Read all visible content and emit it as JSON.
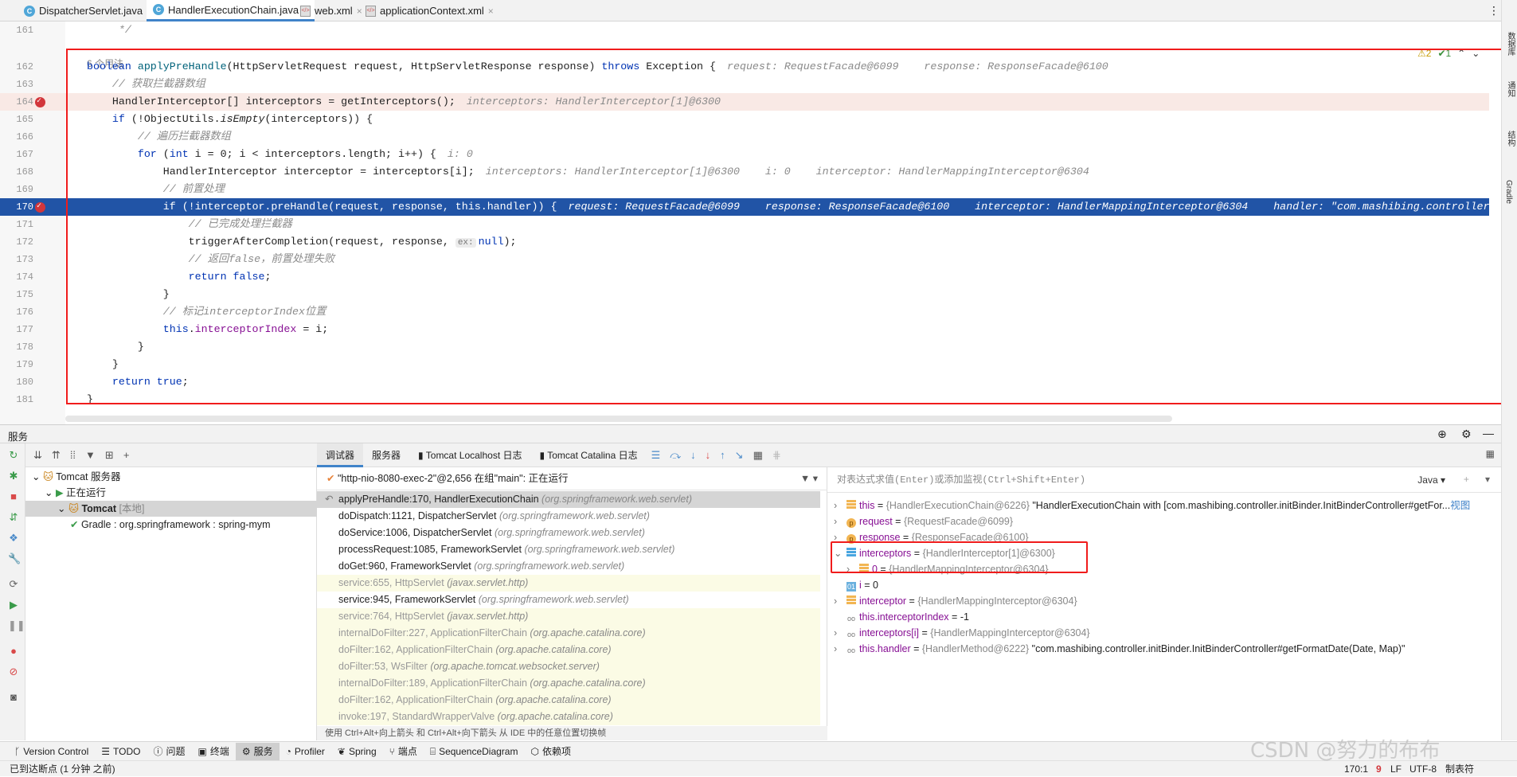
{
  "tabs": [
    {
      "label": "DispatcherServlet.java",
      "icon": "class-icon"
    },
    {
      "label": "HandlerExecutionChain.java",
      "icon": "class-icon",
      "active": true
    },
    {
      "label": "web.xml",
      "icon": "xml-icon"
    },
    {
      "label": "applicationContext.xml",
      "icon": "xml-icon"
    }
  ],
  "editor": {
    "usage": "6 个用法",
    "inspections": {
      "warnings": "⚠2",
      "ok": "✔1"
    },
    "lines": [
      {
        "num": "161",
        "seg": [
          [
            "     */",
            "cm"
          ]
        ]
      },
      {
        "num": "162",
        "seg": [
          [
            "boolean ",
            "kw"
          ],
          [
            "applyPreHandle",
            "fn"
          ],
          [
            "(HttpServletRequest request, HttpServletResponse response) ",
            ""
          ],
          [
            "throws ",
            "kw"
          ],
          [
            "Exception {",
            ""
          ]
        ],
        "hint": "request: RequestFacade@6099    response: ResponseFacade@6100"
      },
      {
        "num": "163",
        "seg": [
          [
            "    // 获取拦截器数组",
            "cm"
          ]
        ]
      },
      {
        "num": "164",
        "seg": [
          [
            "    HandlerInterceptor[] interceptors = getInterceptors();",
            ""
          ]
        ],
        "hint": "interceptors: HandlerInterceptor[1]@6300",
        "bg": "pink",
        "bp": true
      },
      {
        "num": "165",
        "seg": [
          [
            "    ",
            ""
          ],
          [
            "if ",
            "kw"
          ],
          [
            "(!ObjectUtils.",
            ""
          ],
          [
            "isEmpty",
            "it"
          ],
          [
            "(interceptors)) {",
            ""
          ]
        ]
      },
      {
        "num": "166",
        "seg": [
          [
            "        // 遍历拦截器数组",
            "cm"
          ]
        ]
      },
      {
        "num": "167",
        "seg": [
          [
            "        ",
            ""
          ],
          [
            "for ",
            "kw"
          ],
          [
            "(",
            ""
          ],
          [
            "int ",
            "kw"
          ],
          [
            "i = 0; i < interceptors.length; i++) {",
            ""
          ]
        ],
        "hint": "i: 0"
      },
      {
        "num": "168",
        "seg": [
          [
            "            HandlerInterceptor interceptor = interceptors[i];",
            ""
          ]
        ],
        "hint": "interceptors: HandlerInterceptor[1]@6300    i: 0    interceptor: HandlerMappingInterceptor@6304"
      },
      {
        "num": "169",
        "seg": [
          [
            "            // 前置处理",
            "cm"
          ]
        ]
      },
      {
        "num": "170",
        "seg": [
          [
            "            if (!interceptor.preHandle(request, response, this.handler)) {",
            ""
          ]
        ],
        "hint": "request: RequestFacade@6099    response: ResponseFacade@6100    interceptor: HandlerMappingInterceptor@6304    handler: \"com.mashibing.controller.",
        "bg": "sel",
        "bp": true
      },
      {
        "num": "171",
        "seg": [
          [
            "                // 已完成处理拦截器",
            "cm"
          ]
        ]
      },
      {
        "num": "172",
        "seg": [
          [
            "                triggerAfterCompletion(request, response, ",
            ""
          ],
          [
            "ex:",
            "inlay"
          ],
          [
            "null",
            "kw"
          ],
          [
            ");",
            ""
          ]
        ]
      },
      {
        "num": "173",
        "seg": [
          [
            "                // 返回false，前置处理失败",
            "cm"
          ]
        ]
      },
      {
        "num": "174",
        "seg": [
          [
            "                ",
            ""
          ],
          [
            "return false",
            "kw"
          ],
          [
            ";",
            ""
          ]
        ]
      },
      {
        "num": "175",
        "seg": [
          [
            "            }",
            ""
          ]
        ]
      },
      {
        "num": "176",
        "seg": [
          [
            "            // 标记interceptorIndex位置",
            "cm"
          ]
        ]
      },
      {
        "num": "177",
        "seg": [
          [
            "            ",
            ""
          ],
          [
            "this",
            "kw"
          ],
          [
            ".",
            ""
          ],
          [
            "interceptorIndex",
            "fd"
          ],
          [
            " = i;",
            ""
          ]
        ]
      },
      {
        "num": "178",
        "seg": [
          [
            "        }",
            ""
          ]
        ]
      },
      {
        "num": "179",
        "seg": [
          [
            "    }",
            ""
          ]
        ]
      },
      {
        "num": "180",
        "seg": [
          [
            "    ",
            ""
          ],
          [
            "return true",
            "kw"
          ],
          [
            ";",
            ""
          ]
        ]
      },
      {
        "num": "181",
        "seg": [
          [
            "}",
            ""
          ]
        ]
      }
    ]
  },
  "right_strip": [
    "数据库",
    "通知",
    "结构",
    "Gradle"
  ],
  "services": {
    "title": "服务",
    "tree": [
      {
        "label": "Tomcat 服务器",
        "indent": 0
      },
      {
        "label": "正在运行",
        "indent": 1
      },
      {
        "label": "Tomcat",
        "extra": "[本地]",
        "indent": 2,
        "selected": true
      },
      {
        "label": "Gradle : org.springframework : spring-mym",
        "indent": 3
      }
    ],
    "debug_tabs": [
      "调试器",
      "服务器",
      "Tomcat Localhost 日志",
      "Tomcat Catalina 日志"
    ],
    "thread": "\"http-nio-8080-exec-2\"@2,656 在组\"main\": 正在运行",
    "frames": [
      {
        "m": "applyPreHandle:170, HandlerExecutionChain",
        "p": "(org.springframework.web.servlet)",
        "cur": true
      },
      {
        "m": "doDispatch:1121, DispatcherServlet",
        "p": "(org.springframework.web.servlet)"
      },
      {
        "m": "doService:1006, DispatcherServlet",
        "p": "(org.springframework.web.servlet)"
      },
      {
        "m": "processRequest:1085, FrameworkServlet",
        "p": "(org.springframework.web.servlet)"
      },
      {
        "m": "doGet:960, FrameworkServlet",
        "p": "(org.springframework.web.servlet)"
      },
      {
        "m": "service:655, HttpServlet",
        "p": "(javax.servlet.http)",
        "dim": true
      },
      {
        "m": "service:945, FrameworkServlet",
        "p": "(org.springframework.web.servlet)"
      },
      {
        "m": "service:764, HttpServlet",
        "p": "(javax.servlet.http)",
        "dim": true
      },
      {
        "m": "internalDoFilter:227, ApplicationFilterChain",
        "p": "(org.apache.catalina.core)",
        "dim": true
      },
      {
        "m": "doFilter:162, ApplicationFilterChain",
        "p": "(org.apache.catalina.core)",
        "dim": true
      },
      {
        "m": "doFilter:53, WsFilter",
        "p": "(org.apache.tomcat.websocket.server)",
        "dim": true
      },
      {
        "m": "internalDoFilter:189, ApplicationFilterChain",
        "p": "(org.apache.catalina.core)",
        "dim": true
      },
      {
        "m": "doFilter:162, ApplicationFilterChain",
        "p": "(org.apache.catalina.core)",
        "dim": true
      },
      {
        "m": "invoke:197, StandardWrapperValve",
        "p": "(org.apache.catalina.core)",
        "dim": true
      }
    ],
    "frames_hint": "使用 Ctrl+Alt+向上箭头 和 Ctrl+Alt+向下箭头 从 IDE 中的任意位置切换帧",
    "eval_placeholder": "对表达式求值(Enter)或添加监视(Ctrl+Shift+Enter)",
    "lang": "Java ▾",
    "variables": [
      {
        "exp": "›",
        "icon": "field",
        "name": "this",
        "val": "{HandlerExecutionChain@6226}",
        "str": " \"HandlerExecutionChain with [com.mashibing.controller.initBinder.InitBinderController#getFor...",
        "link": "视图"
      },
      {
        "exp": "›",
        "icon": "param",
        "name": "request",
        "val": "{RequestFacade@6099}"
      },
      {
        "exp": "›",
        "icon": "param",
        "name": "response",
        "val": "{ResponseFacade@6100}"
      },
      {
        "exp": "⌄",
        "icon": "arr",
        "name": "interceptors",
        "val": "{HandlerInterceptor[1]@6300}"
      },
      {
        "exp": "›",
        "icon": "field",
        "name": "0",
        "val": "{HandlerMappingInterceptor@6304}",
        "indent": 1
      },
      {
        "exp": "",
        "icon": "prim",
        "name": "i",
        "val": "0",
        "plain": true
      },
      {
        "exp": "›",
        "icon": "field",
        "name": "interceptor",
        "val": "{HandlerMappingInterceptor@6304}"
      },
      {
        "exp": "",
        "icon": "watch",
        "name": "this.interceptorIndex",
        "val": "-1",
        "plain": true
      },
      {
        "exp": "›",
        "icon": "watch",
        "name": "interceptors[i]",
        "val": "{HandlerMappingInterceptor@6304}"
      },
      {
        "exp": "›",
        "icon": "watch",
        "name": "this.handler",
        "val": "{HandlerMethod@6222}",
        "str": " \"com.mashibing.controller.initBinder.InitBinderController#getFormatDate(Date, Map)\""
      }
    ]
  },
  "bottom_tools": [
    "Version Control",
    "TODO",
    "问题",
    "终端",
    "服务",
    "Profiler",
    "Spring",
    "端点",
    "SequenceDiagram",
    "依赖项"
  ],
  "bottom_active": "服务",
  "status": {
    "message": "已到达断点 (1 分钟 之前)",
    "position": "170:1",
    "line_sep": "LF",
    "encoding": "UTF-8",
    "indent": "制表符"
  },
  "watermark": "CSDN @努力的布布",
  "colors": {
    "selection": "#2154a6",
    "breakpoint": "#d2363b",
    "highlight_box": "#f01c1c",
    "accent": "#4083c9"
  }
}
